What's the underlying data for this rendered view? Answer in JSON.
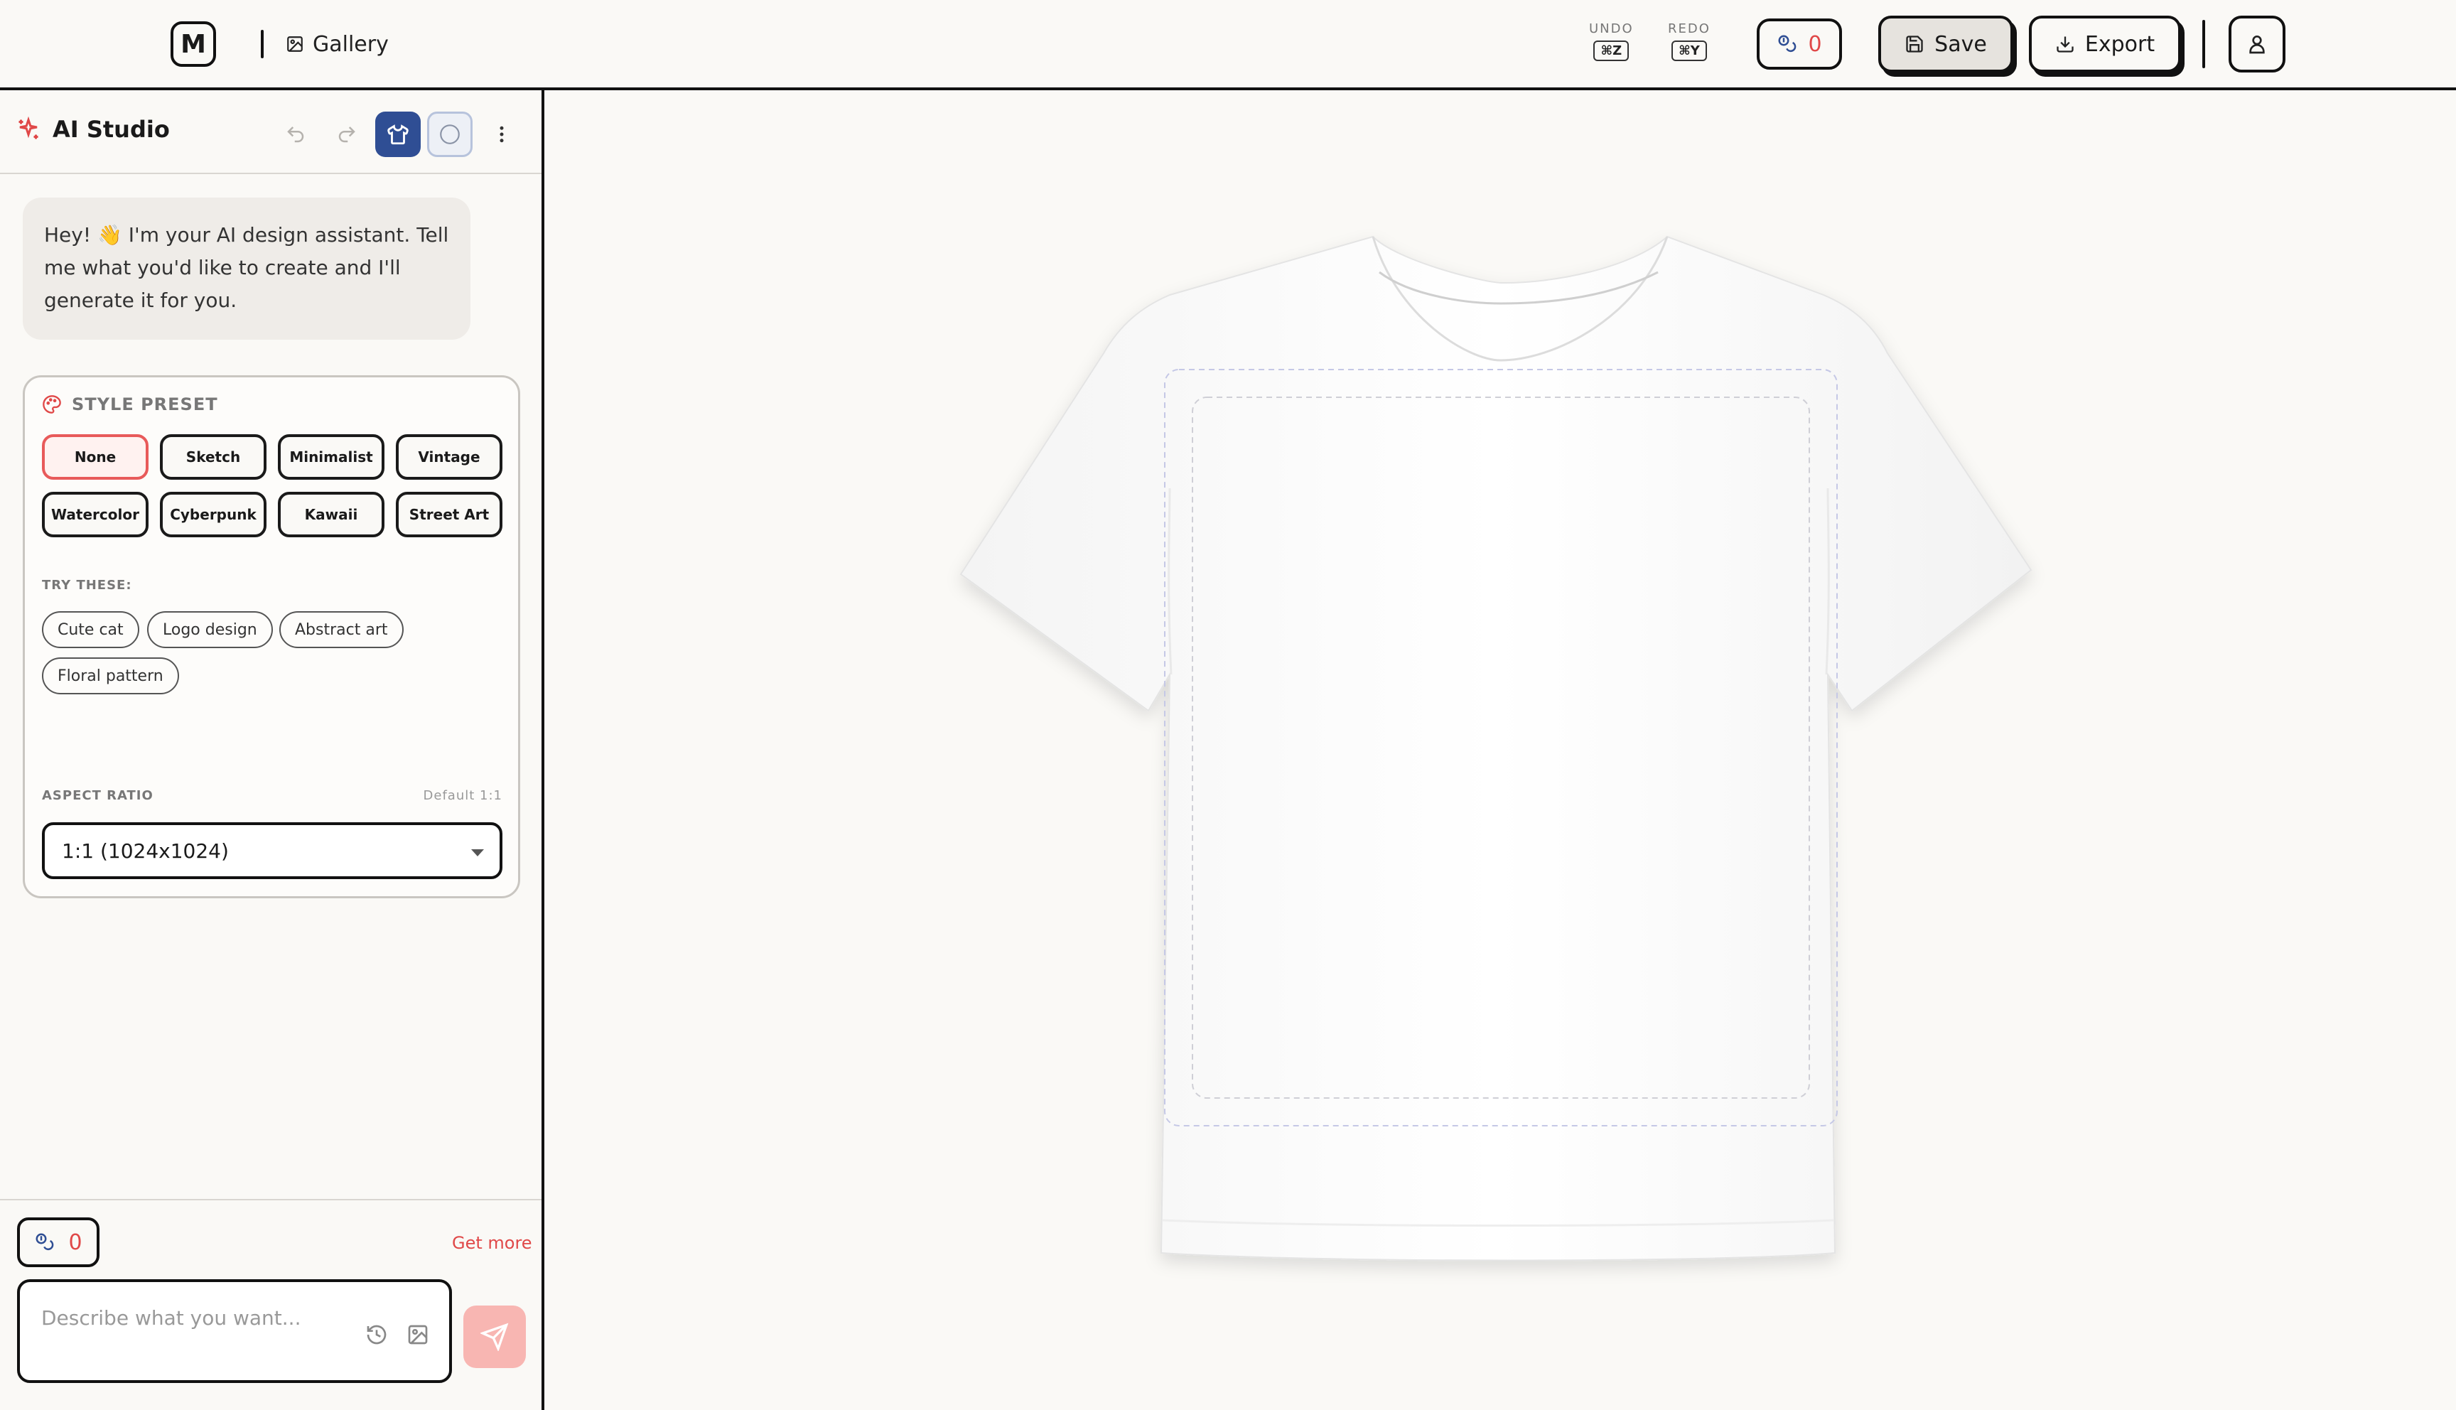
{
  "header": {
    "logo_letter": "M",
    "gallery_label": "Gallery",
    "undo_label": "UNDO",
    "undo_key": "⌘Z",
    "redo_label": "REDO",
    "redo_key": "⌘Y",
    "credits_count": "0",
    "save_label": "Save",
    "export_label": "Export"
  },
  "sidebar": {
    "title": "AI Studio",
    "assistant_message": "Hey! 👋 I'm your AI design assistant. Tell me what you'd like to create and I'll generate it for you.",
    "style_preset_label": "STYLE PRESET",
    "presets": [
      "None",
      "Sketch",
      "Minimalist",
      "Vintage",
      "Watercolor",
      "Cyberpunk",
      "Kawaii",
      "Street Art"
    ],
    "selected_preset": "None",
    "try_these_label": "TRY THESE:",
    "suggestions": [
      "Cute cat",
      "Logo design",
      "Abstract art",
      "Floral pattern"
    ],
    "aspect_ratio_label": "ASPECT RATIO",
    "aspect_ratio_default": "Default 1:1",
    "aspect_ratio_value": "1:1 (1024x1024)",
    "credits_count": "0",
    "get_more_label": "Get more",
    "prompt_placeholder": "Describe what you want..."
  },
  "colors": {
    "accent": "#e04848",
    "active_tool": "#2f4e94",
    "send_button": "#f8b6b2",
    "background": "#faf9f6"
  }
}
